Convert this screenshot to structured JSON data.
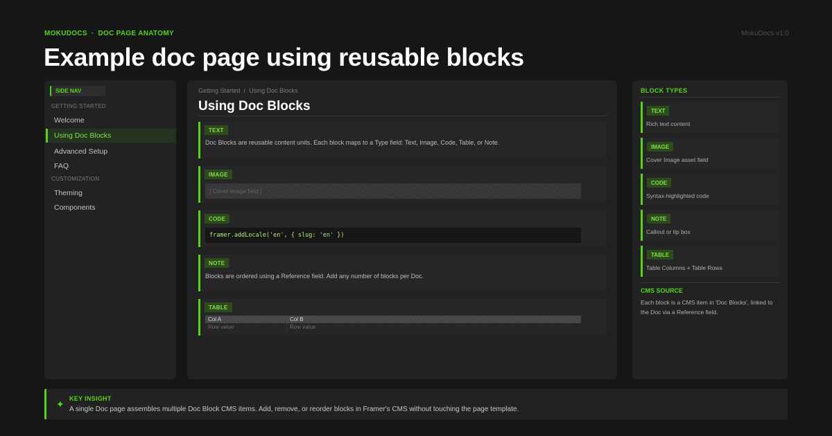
{
  "header": {
    "brand": "MOKUDOCS",
    "separator": "·",
    "section": "DOC PAGE ANATOMY",
    "version": "MokuDocs v1.0",
    "headline": "Example doc page using reusable blocks"
  },
  "sidebar": {
    "badge": "SIDE NAV",
    "groups": [
      {
        "label": "GETTING STARTED",
        "items": [
          "Welcome",
          "Using Doc Blocks",
          "Advanced Setup",
          "FAQ"
        ]
      },
      {
        "label": "CUSTOMIZATION",
        "items": [
          "Theming",
          "Components"
        ]
      }
    ],
    "active_item": "Using Doc Blocks"
  },
  "main": {
    "breadcrumb": [
      "Getting Started",
      "/",
      "Using Doc Blocks"
    ],
    "title": "Using Doc Blocks",
    "blocks": [
      {
        "type": "TEXT",
        "content": "Doc Blocks are reusable content units. Each block maps to a Type field: Text, Image, Code, Table, or Note."
      },
      {
        "type": "IMAGE",
        "content": "[ Cover image field ]"
      },
      {
        "type": "CODE",
        "content": "framer.addLocale('en', { slug: 'en' })"
      },
      {
        "type": "NOTE",
        "content": "Blocks are ordered using a Reference field. Add any number of blocks per Doc."
      },
      {
        "type": "TABLE",
        "columns": [
          "Col A",
          "Col B"
        ],
        "row": [
          "Row value",
          "Row value"
        ]
      }
    ]
  },
  "right": {
    "title": "BLOCK TYPES",
    "types": [
      {
        "tag": "TEXT",
        "desc": "Rich text content"
      },
      {
        "tag": "IMAGE",
        "desc": "Cover Image asset field"
      },
      {
        "tag": "CODE",
        "desc": "Syntax-highlighted code"
      },
      {
        "tag": "NOTE",
        "desc": "Callout or tip box"
      },
      {
        "tag": "TABLE",
        "desc": "Table Columns + Table Rows"
      }
    ],
    "cms_title": "CMS SOURCE",
    "cms_text": "Each block is a CMS item in 'Doc Blocks', linked to the Doc via a Reference field."
  },
  "insight": {
    "icon": "sparkle-icon",
    "title": "KEY INSIGHT",
    "text": "A single Doc page assembles multiple Doc Block CMS items. Add, remove, or reorder blocks in Framer's CMS without touching the page template."
  },
  "colors": {
    "accent": "#57d31e",
    "background": "#161616",
    "panel": "#222222"
  }
}
